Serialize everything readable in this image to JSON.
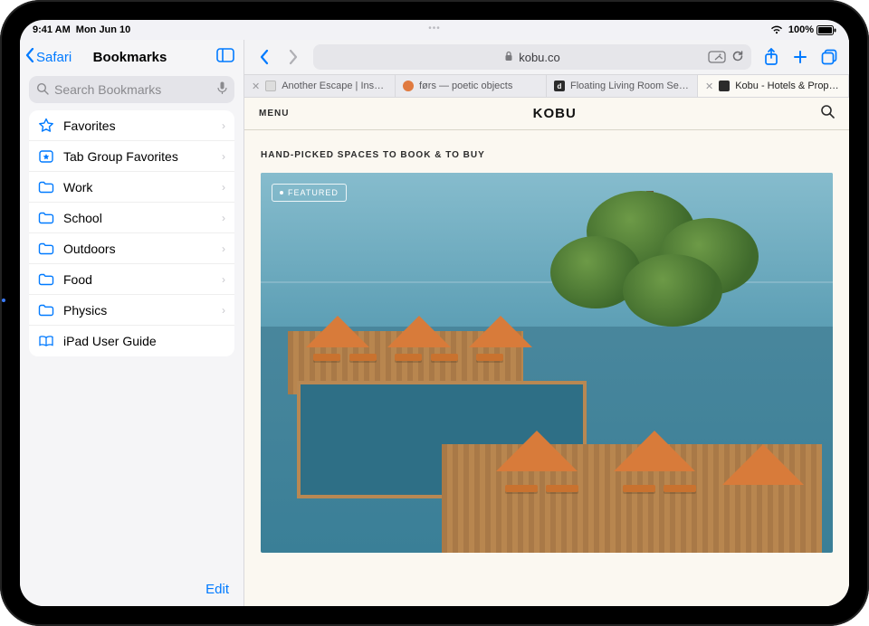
{
  "status": {
    "time": "9:41 AM",
    "date": "Mon Jun 10",
    "battery_pct": "100%"
  },
  "sidebar": {
    "back_label": "Safari",
    "title": "Bookmarks",
    "search_placeholder": "Search Bookmarks",
    "items": [
      {
        "icon": "star",
        "label": "Favorites",
        "chevron": true
      },
      {
        "icon": "tabstar",
        "label": "Tab Group Favorites",
        "chevron": true
      },
      {
        "icon": "folder",
        "label": "Work",
        "chevron": true
      },
      {
        "icon": "folder",
        "label": "School",
        "chevron": true
      },
      {
        "icon": "folder",
        "label": "Outdoors",
        "chevron": true
      },
      {
        "icon": "folder",
        "label": "Food",
        "chevron": true
      },
      {
        "icon": "folder",
        "label": "Physics",
        "chevron": true
      },
      {
        "icon": "book",
        "label": "iPad User Guide",
        "chevron": false
      }
    ],
    "edit_label": "Edit"
  },
  "toolbar": {
    "url_host": "kobu.co"
  },
  "tabs": [
    {
      "title": "Another Escape | Inspir…",
      "favicon": "#9aa0a6",
      "active": false,
      "closable": true
    },
    {
      "title": "førs — poetic objects",
      "favicon": "#e07a3f",
      "active": false,
      "closable": false
    },
    {
      "title": "Floating Living Room Se…",
      "favicon": "#2b2b2b",
      "active": false,
      "closable": false,
      "favicon_letter": "d"
    },
    {
      "title": "Kobu - Hotels & Propert…",
      "favicon": "#2b2b2b",
      "active": true,
      "closable": true
    }
  ],
  "page": {
    "menu_label": "MENU",
    "logo": "KOBU",
    "tagline": "HAND-PICKED SPACES TO BOOK & TO BUY",
    "badge": "FEATURED"
  },
  "colors": {
    "ios_blue": "#007aff"
  }
}
